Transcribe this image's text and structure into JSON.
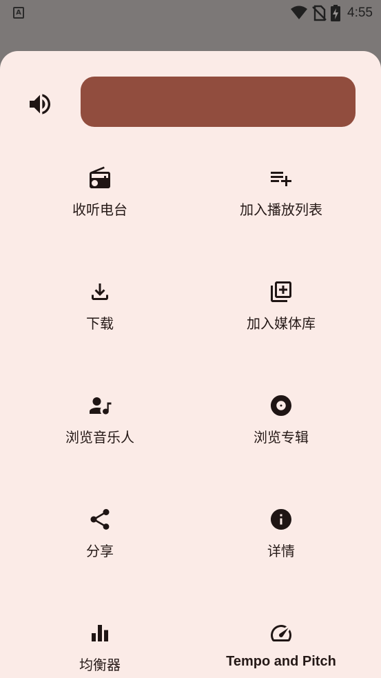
{
  "status_bar": {
    "app_icon_letter": "A",
    "time": "4:55",
    "icons": [
      "wifi-icon",
      "no-sim-icon",
      "battery-charging-icon"
    ]
  },
  "volume": {
    "icon": "volume-up-icon",
    "level": 1.0,
    "bar_color": "#914d3e"
  },
  "colors": {
    "sheet_background": "#fbebe7",
    "scrim": "#7c7877",
    "text": "#251917"
  },
  "menu": {
    "items": [
      {
        "label": "收听电台",
        "icon": "radio-icon"
      },
      {
        "label": "加入播放列表",
        "icon": "playlist-add-icon"
      },
      {
        "label": "下载",
        "icon": "download-icon"
      },
      {
        "label": "加入媒体库",
        "icon": "library-add-icon"
      },
      {
        "label": "浏览音乐人",
        "icon": "artist-icon"
      },
      {
        "label": "浏览专辑",
        "icon": "album-icon"
      },
      {
        "label": "分享",
        "icon": "share-icon"
      },
      {
        "label": "详情",
        "icon": "info-icon"
      },
      {
        "label": "均衡器",
        "icon": "equalizer-icon"
      },
      {
        "label": "Tempo and Pitch",
        "icon": "speed-gauge-icon"
      }
    ]
  }
}
